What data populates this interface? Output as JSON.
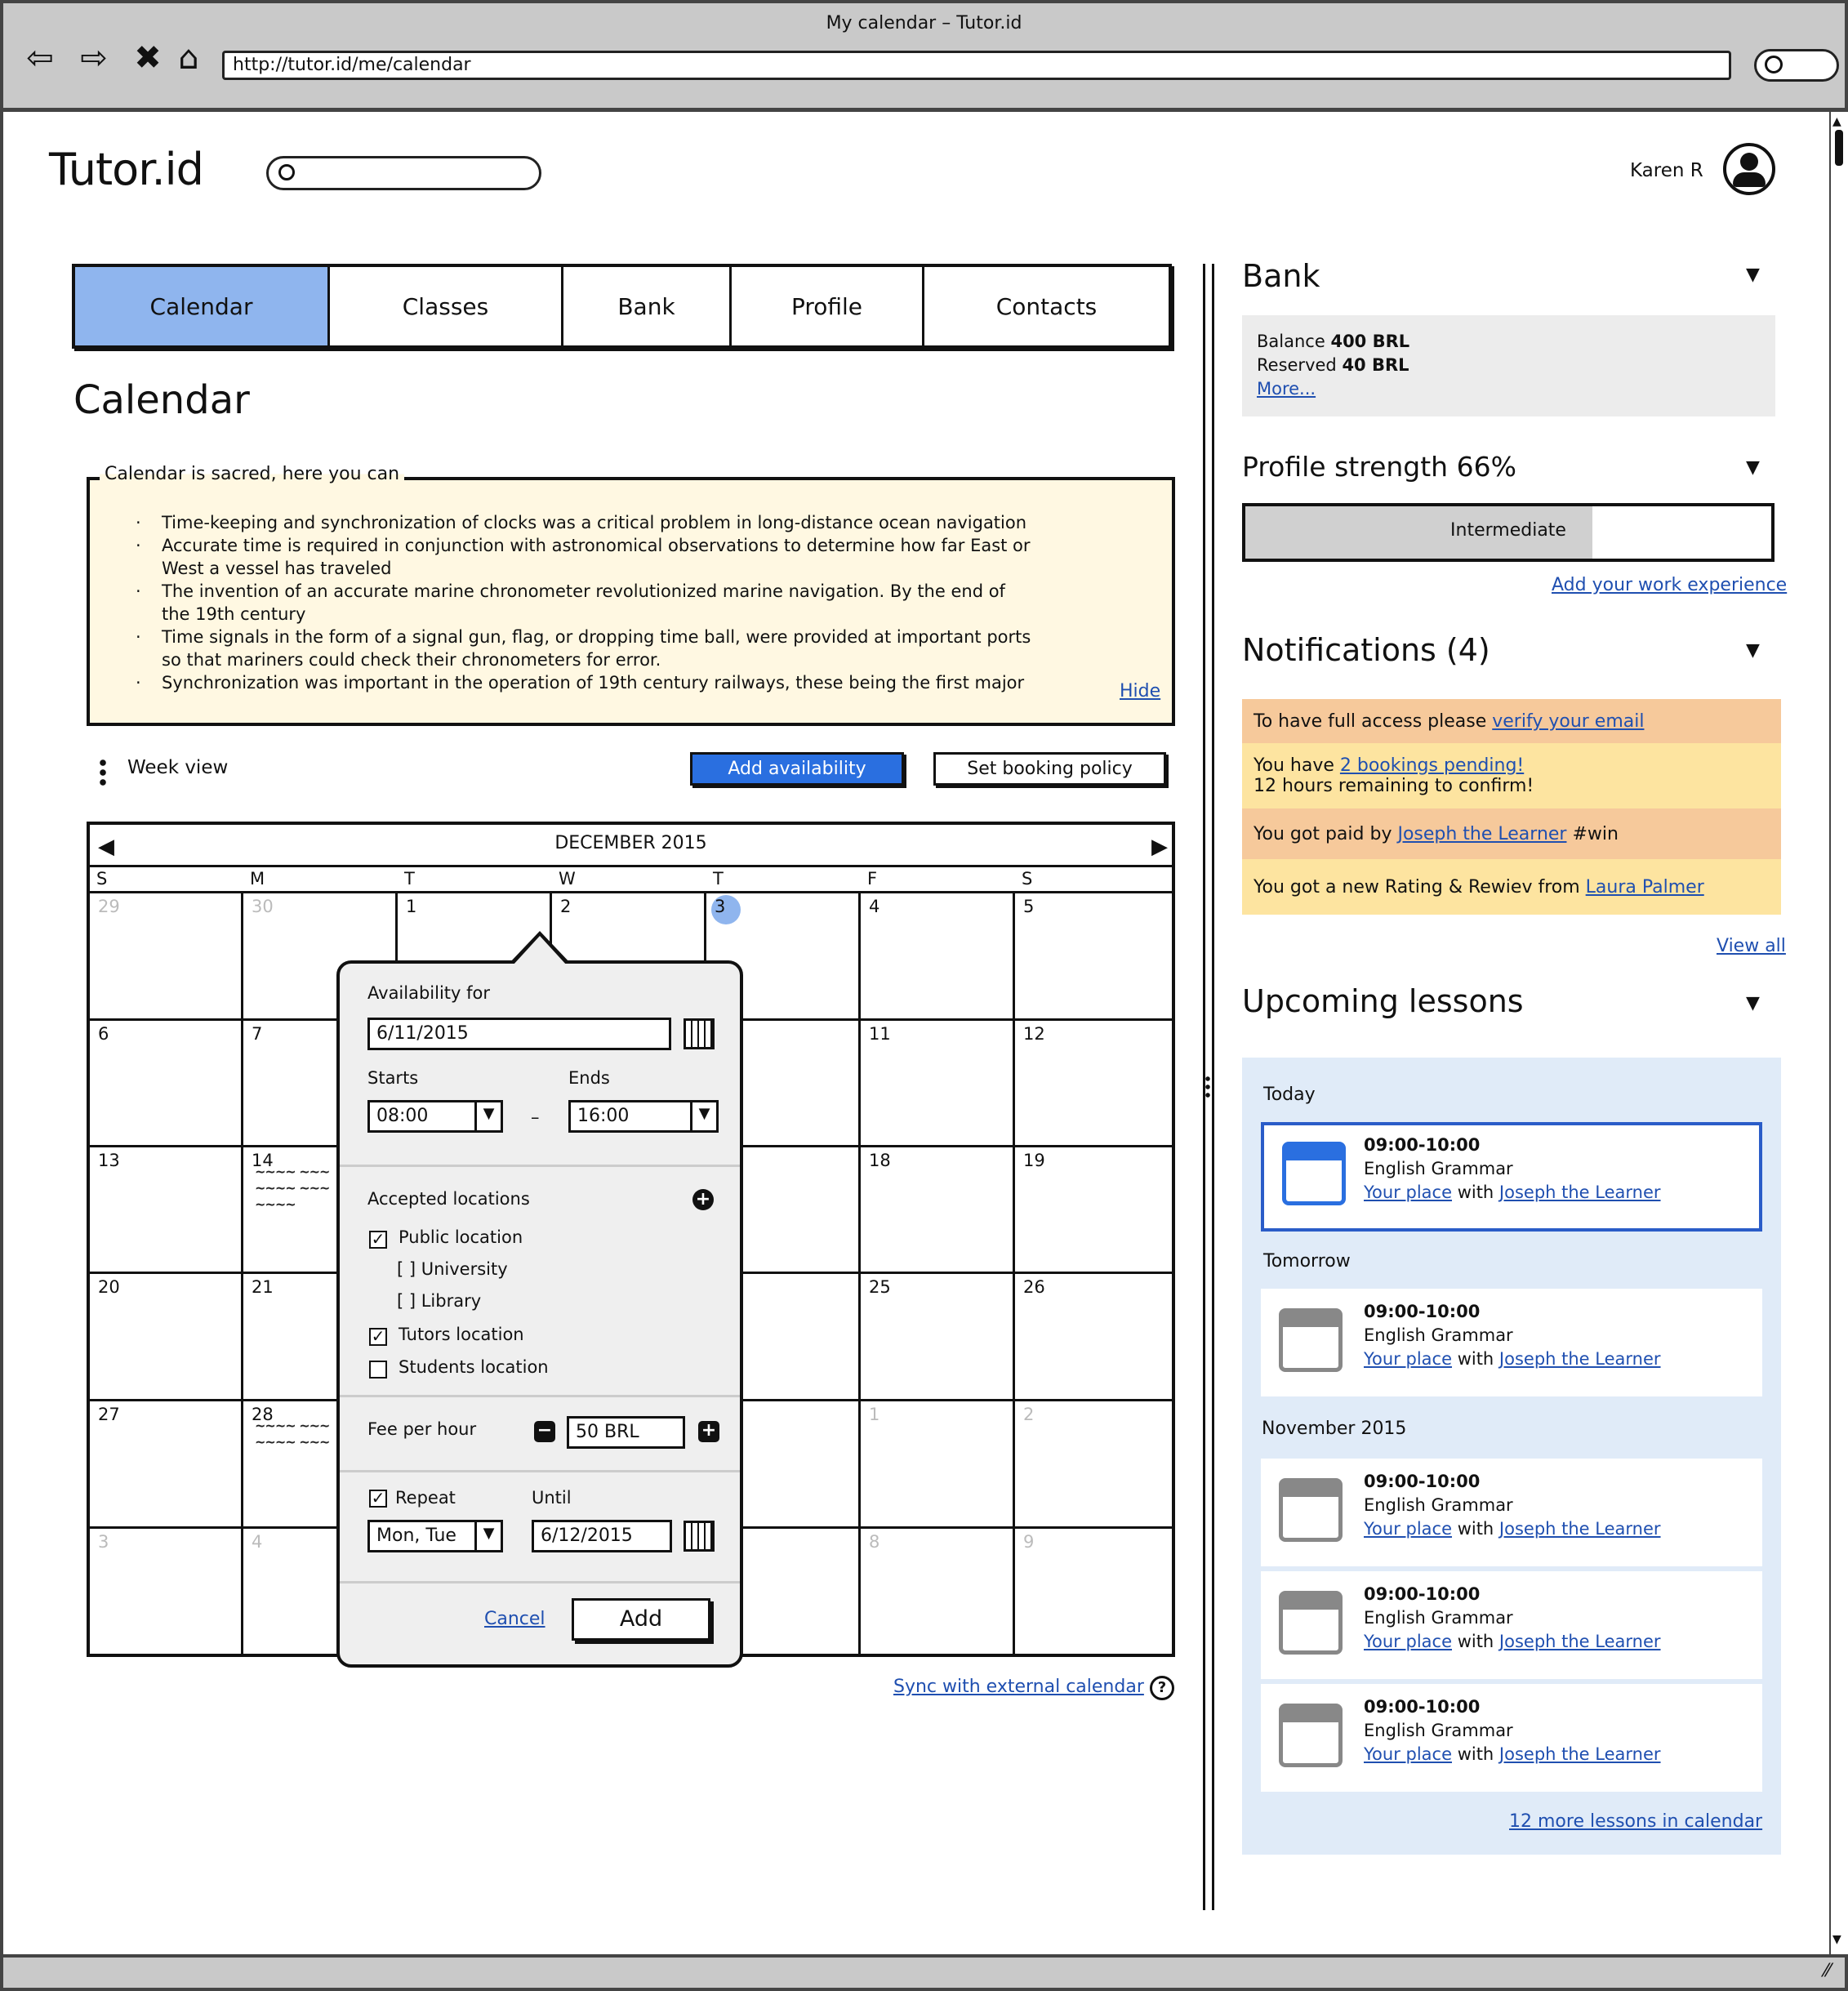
{
  "browser": {
    "window_title": "My calendar – Tutor.id",
    "url": "http://tutor.id/me/calendar"
  },
  "header": {
    "logo": "Tutor.id",
    "user_name": "Karen R"
  },
  "tabs": [
    {
      "label": "Calendar",
      "active": true
    },
    {
      "label": "Classes"
    },
    {
      "label": "Bank"
    },
    {
      "label": "Profile"
    },
    {
      "label": "Contacts"
    }
  ],
  "page_title": "Calendar",
  "info": {
    "legend": "Calendar is sacred, here you can",
    "items": [
      "Time-keeping and synchronization of clocks was a critical problem in long-distance ocean navigation",
      "Accurate time is required in conjunction with astronomical observations to determine how far East or West a vessel has traveled",
      "The invention of an accurate marine chronometer revolutionized marine navigation. By the end of the 19th century",
      "Time signals in the form of a signal gun, flag, or dropping time ball, were provided at important ports so that mariners could check their chronometers for error.",
      "Synchronization was important in the operation of 19th century railways, these being the first major"
    ],
    "hide_link": "Hide"
  },
  "toolbar": {
    "view_label": "Week view",
    "add_availability": "Add availability",
    "set_booking_policy": "Set booking policy"
  },
  "calendar": {
    "month_label": "DECEMBER 2015",
    "days_of_week": [
      "S",
      "M",
      "T",
      "W",
      "T",
      "F",
      "S"
    ],
    "weeks": [
      [
        {
          "d": "29",
          "out": true
        },
        {
          "d": "30",
          "out": true
        },
        {
          "d": "1"
        },
        {
          "d": "2"
        },
        {
          "d": "3",
          "today": true
        },
        {
          "d": "4"
        },
        {
          "d": "5"
        }
      ],
      [
        {
          "d": "6"
        },
        {
          "d": "7"
        },
        {
          "d": ""
        },
        {
          "d": ""
        },
        {
          "d": ""
        },
        {
          "d": "11"
        },
        {
          "d": "12"
        }
      ],
      [
        {
          "d": "13"
        },
        {
          "d": "14"
        },
        {
          "d": ""
        },
        {
          "d": ""
        },
        {
          "d": ""
        },
        {
          "d": "18"
        },
        {
          "d": "19"
        }
      ],
      [
        {
          "d": "20"
        },
        {
          "d": "21"
        },
        {
          "d": ""
        },
        {
          "d": ""
        },
        {
          "d": ""
        },
        {
          "d": "25"
        },
        {
          "d": "26"
        }
      ],
      [
        {
          "d": "27"
        },
        {
          "d": "28"
        },
        {
          "d": ""
        },
        {
          "d": ""
        },
        {
          "d": ""
        },
        {
          "d": "1",
          "out": true
        },
        {
          "d": "2",
          "out": true
        }
      ],
      [
        {
          "d": "3",
          "out": true
        },
        {
          "d": "4",
          "out": true
        },
        {
          "d": ""
        },
        {
          "d": ""
        },
        {
          "d": ""
        },
        {
          "d": "8",
          "out": true
        },
        {
          "d": "9",
          "out": true
        }
      ]
    ],
    "sync_link": "Sync with external calendar"
  },
  "popover": {
    "availability_for_label": "Availability for",
    "date_value": "6/11/2015",
    "starts_label": "Starts",
    "ends_label": "Ends",
    "starts_value": "08:00",
    "ends_value": "16:00",
    "dash": "–",
    "locations_label": "Accepted locations",
    "locations": [
      {
        "label": "Public location",
        "checked": true,
        "style": "checkbox"
      },
      {
        "label": "[ ] University",
        "style": "text"
      },
      {
        "label": "[ ] Library",
        "style": "text"
      },
      {
        "label": "Tutors location",
        "checked": true,
        "style": "checkbox"
      },
      {
        "label": "Students location",
        "checked": false,
        "style": "checkbox"
      }
    ],
    "fee_label": "Fee per hour",
    "fee_value": "50 BRL",
    "repeat_label": "Repeat",
    "until_label": "Until",
    "repeat_value": "Mon, Tue",
    "until_value": "6/12/2015",
    "cancel": "Cancel",
    "add": "Add"
  },
  "bank": {
    "title": "Bank",
    "balance_label": "Balance",
    "balance_value": "400 BRL",
    "reserved_label": "Reserved",
    "reserved_value": "40 BRL",
    "more_link": "More..."
  },
  "profile_strength": {
    "title": "Profile strength 66%",
    "level_label": "Intermediate",
    "percent": 66,
    "add_experience_link": "Add your work experience"
  },
  "notifications": {
    "title": "Notifications (4)",
    "items": [
      {
        "pre": "To have full access please ",
        "link": "verify your email",
        "post": "",
        "line2": "",
        "color": "#f6c99b"
      },
      {
        "pre": "You have ",
        "link": "2 bookings pending!",
        "post": "",
        "line2": "12 hours remaining to confirm!",
        "color": "#fde4a0"
      },
      {
        "pre": "You got paid by ",
        "link": "Joseph the Learner",
        "post": " #win",
        "line2": "",
        "color": "#f6c99b"
      },
      {
        "pre": "You got a new Rating & Rewiev from ",
        "link": "Laura Palmer",
        "post": "",
        "line2": "",
        "color": "#fde4a0"
      }
    ],
    "view_all": "View all"
  },
  "upcoming": {
    "title": "Upcoming lessons",
    "group_today": "Today",
    "group_tomorrow": "Tomorrow",
    "group_month": "November 2015",
    "lessons": [
      {
        "time": "09:00-10:00",
        "subject": "English Grammar",
        "place": "Your place",
        "with": " with ",
        "person": "Joseph the Learner"
      },
      {
        "time": "09:00-10:00",
        "subject": "English Grammar",
        "place": "Your place",
        "with": " with ",
        "person": "Joseph the Learner"
      },
      {
        "time": "09:00-10:00",
        "subject": "English Grammar",
        "place": "Your place",
        "with": " with ",
        "person": "Joseph the Learner"
      },
      {
        "time": "09:00-10:00",
        "subject": "English Grammar",
        "place": "Your place",
        "with": " with ",
        "person": "Joseph the Learner"
      },
      {
        "time": "09:00-10:00",
        "subject": "English Grammar",
        "place": "Your place",
        "with": " with ",
        "person": "Joseph the Learner"
      }
    ],
    "more_link": "12 more lessons in calendar"
  }
}
